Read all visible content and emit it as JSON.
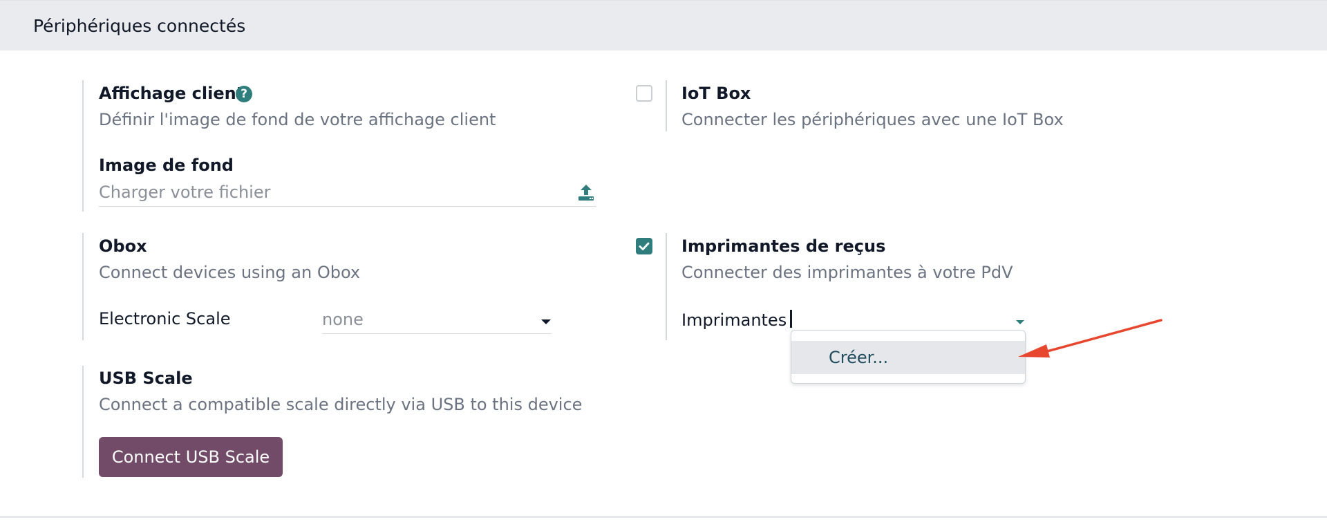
{
  "section": {
    "title": "Périphériques connectés"
  },
  "customer_display": {
    "title": "Affichage client",
    "description": "Définir l'image de fond de votre affichage client",
    "help_icon": "question-circle-icon",
    "background_image": {
      "label": "Image de fond",
      "placeholder": "Charger votre fichier",
      "icon": "upload-icon"
    }
  },
  "iot_box": {
    "title": "IoT Box",
    "description": "Connecter les périphériques avec une IoT Box",
    "checked": false
  },
  "obox": {
    "title": "Obox",
    "description": "Connect devices using an Obox",
    "electronic_scale": {
      "label": "Electronic Scale",
      "value": "none"
    }
  },
  "receipt_printers": {
    "title": "Imprimantes de reçus",
    "description": "Connecter des imprimantes à votre PdV",
    "checked": true,
    "printers": {
      "label": "Imprimantes",
      "value": "",
      "dropdown_items": [
        "Créer..."
      ]
    }
  },
  "usb_scale": {
    "title": "USB Scale",
    "description": "Connect a compatible scale directly via USB to this device",
    "button_label": "Connect USB Scale"
  },
  "colors": {
    "accent": "#2f7d7d",
    "button": "#714b67",
    "annotation_arrow": "#e8472f",
    "header_bg": "#e9ebee"
  }
}
